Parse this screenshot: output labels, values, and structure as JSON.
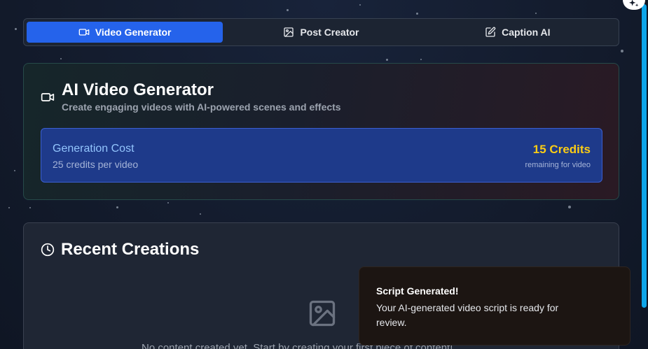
{
  "tabs": [
    {
      "label": "Video Generator",
      "icon": "video-icon",
      "active": true
    },
    {
      "label": "Post Creator",
      "icon": "image-icon",
      "active": false
    },
    {
      "label": "Caption AI",
      "icon": "edit-icon",
      "active": false
    }
  ],
  "generator": {
    "icon": "video-icon",
    "title": "AI Video Generator",
    "subtitle": "Create engaging videos with AI-powered scenes and effects",
    "cost": {
      "label": "Generation Cost",
      "description": "25 credits per video",
      "credits": "15 Credits",
      "remaining": "remaining for video"
    }
  },
  "recent": {
    "icon": "clock-icon",
    "title": "Recent Creations",
    "empty_icon": "image-icon",
    "empty_text": "No content created yet. Start by creating your first piece of content!"
  },
  "toast": {
    "title": "Script Generated!",
    "body": "Your AI-generated video script is ready for review."
  },
  "colors": {
    "accent": "#2563eb",
    "credits": "#facc15",
    "scrollbar": "#0ea5e9"
  }
}
